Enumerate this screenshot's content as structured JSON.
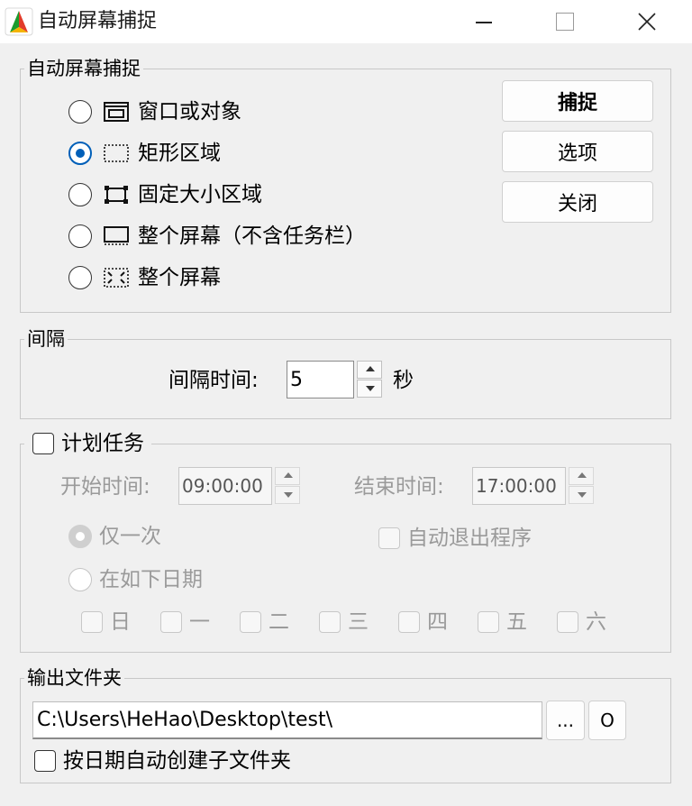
{
  "window": {
    "title": "自动屏幕捕捉",
    "app_icon": "color-wedge-icon",
    "controls": [
      "minimize-icon",
      "maximize-icon",
      "close-icon"
    ]
  },
  "capture_group": {
    "legend": "自动屏幕捕捉",
    "options": [
      {
        "label": "窗口或对象",
        "icon": "window-object-icon",
        "checked": false
      },
      {
        "label": "矩形区域",
        "icon": "rectangle-region-icon",
        "checked": true
      },
      {
        "label": "固定大小区域",
        "icon": "fixed-size-region-icon",
        "checked": false
      },
      {
        "label": "整个屏幕（不含任务栏）",
        "icon": "screen-no-taskbar-icon",
        "checked": false
      },
      {
        "label": "整个屏幕",
        "icon": "full-screen-icon",
        "checked": false
      }
    ],
    "buttons": {
      "capture": "捕捉",
      "options": "选项",
      "close": "关闭"
    }
  },
  "interval_group": {
    "legend": "间隔",
    "label": "间隔时间:",
    "value": "5",
    "unit": "秒"
  },
  "schedule_group": {
    "legend": "计划任务",
    "checked": false,
    "start_label": "开始时间:",
    "start_value": "09:00:00",
    "end_label": "结束时间:",
    "end_value": "17:00:00",
    "once_label": "仅一次",
    "once_checked": true,
    "dates_label": "在如下日期",
    "auto_exit_label": "自动退出程序",
    "days": [
      "日",
      "一",
      "二",
      "三",
      "四",
      "五",
      "六"
    ]
  },
  "output_group": {
    "legend": "输出文件夹",
    "path": "C:\\Users\\HeHao\\Desktop\\test\\",
    "browse_label": "...",
    "open_label": "O",
    "subfolder_label": "按日期自动创建子文件夹",
    "subfolder_checked": false
  },
  "colors": {
    "accent": "#005fb8",
    "disabled_text": "#9a9a9a",
    "group_border": "#c8c8c8"
  }
}
